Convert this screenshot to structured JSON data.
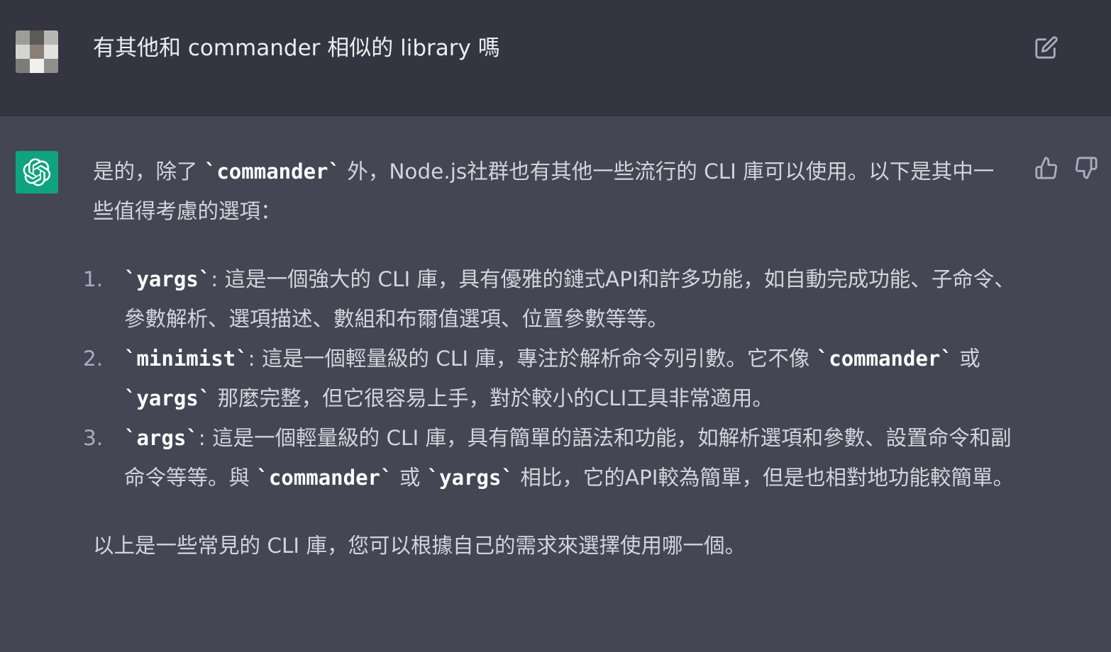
{
  "user_message": {
    "text": "有其他和 commander 相似的 library 嗎"
  },
  "assistant_message": {
    "intro": {
      "t1": "是的，除了 ",
      "c1": "`commander`",
      "t2": " 外，Node.js社群也有其他一些流行的 CLI 庫可以使用。以下是其中一些值得考慮的選項："
    },
    "items": [
      {
        "number": "1.",
        "c1": "`yargs`",
        "t1": ": 這是一個強大的 CLI 庫，具有優雅的鏈式API和許多功能，如自動完成功能、子命令、參數解析、選項描述、數組和布爾值選項、位置參數等等。"
      },
      {
        "number": "2.",
        "c1": "`minimist`",
        "t1": ": 這是一個輕量級的 CLI 庫，專注於解析命令列引數。它不像 ",
        "c2": "`commander`",
        "t2": " 或 ",
        "c3": "`yargs`",
        "t3": " 那麼完整，但它很容易上手，對於較小的CLI工具非常適用。"
      },
      {
        "number": "3.",
        "c1": "`args`",
        "t1": ": 這是一個輕量級的 CLI 庫，具有簡單的語法和功能，如解析選項和參數、設置命令和副命令等等。與 ",
        "c2": "`commander`",
        "t2": " 或 ",
        "c3": "`yargs`",
        "t3": " 相比，它的API較為簡單，但是也相對地功能較簡單。"
      }
    ],
    "outro": "以上是一些常見的 CLI 庫，您可以根據自己的需求來選擇使用哪一個。"
  },
  "icons": {
    "edit": "edit-icon",
    "thumbs_up": "thumbs-up-icon",
    "thumbs_down": "thumbs-down-icon",
    "assistant_logo": "openai-logo-icon"
  },
  "colors": {
    "user_bg": "#343541",
    "assistant_bg": "#444654",
    "assistant_avatar": "#10a37f",
    "text": "#d1d5db"
  }
}
